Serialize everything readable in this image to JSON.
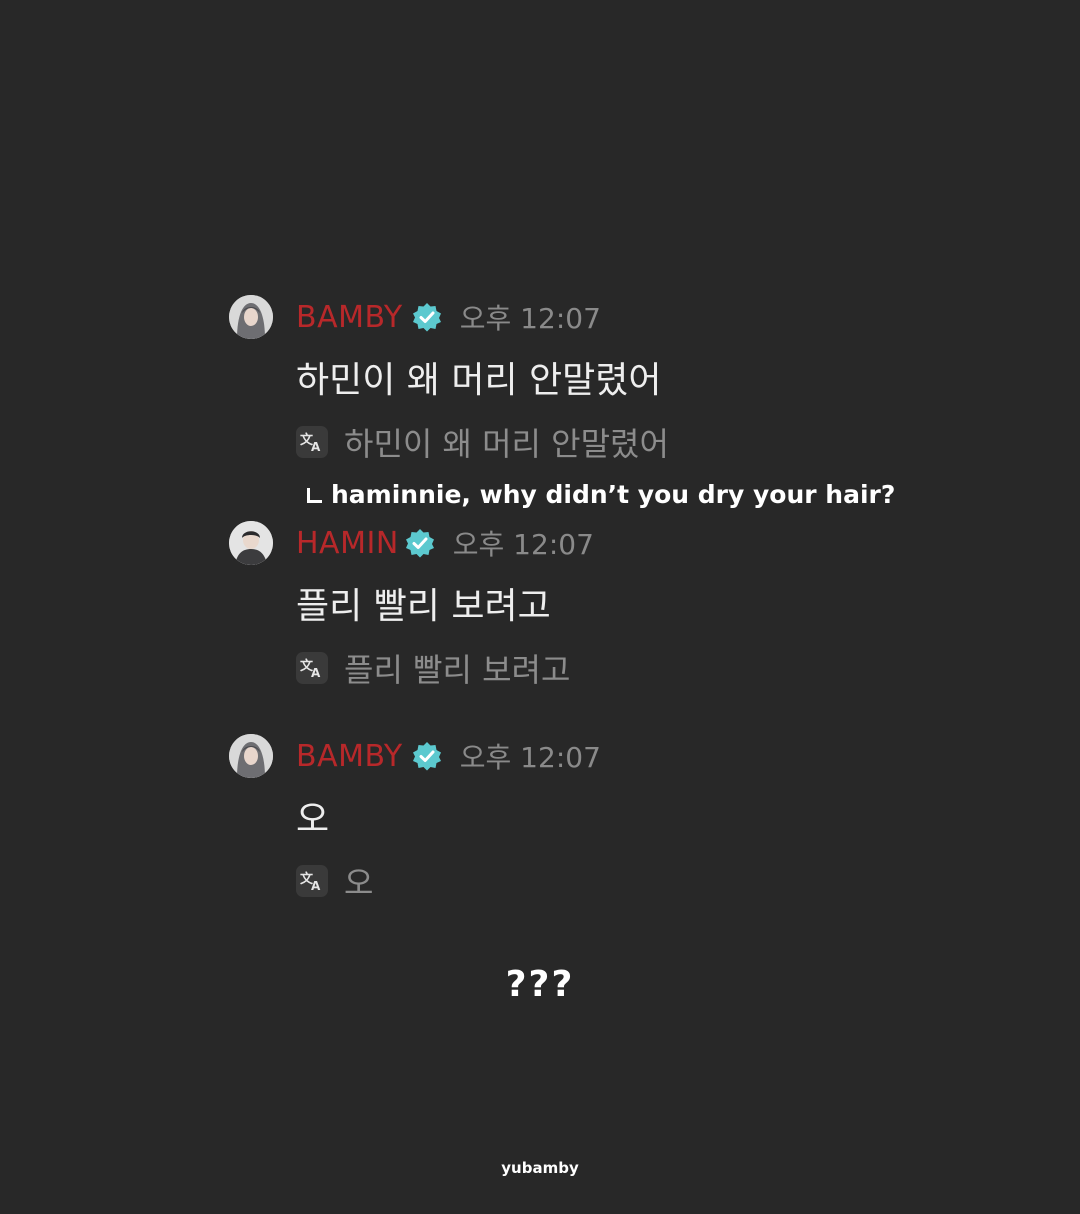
{
  "messages": [
    {
      "username": "BAMBY",
      "time": "오후 12:07",
      "text": "하민이 왜 머리 안말렸어",
      "translation": "하민이 왜 머리 안말렸어",
      "username_color": "#b8282a"
    },
    {
      "username": "HAMIN",
      "time": "오후 12:07",
      "text": "플리 빨리 보려고",
      "translation": "플리 빨리 보려고",
      "username_color": "#b8282a"
    },
    {
      "username": "BAMBY",
      "time": "오후 12:07",
      "text": "오",
      "translation": "오",
      "username_color": "#b8282a"
    }
  ],
  "icons": {
    "verified": "verified-badge-icon",
    "translate": "translate-icon",
    "avatar": "avatar"
  },
  "colors": {
    "background": "#282828",
    "verified_badge": "#5cc9cf",
    "timestamp": "#8a8a8a",
    "translation_text": "#8c8c8c"
  },
  "overlay": {
    "subtitle": "haminnie, why didn’t you dry your hair?",
    "reaction": "???",
    "watermark": "yubamby"
  }
}
